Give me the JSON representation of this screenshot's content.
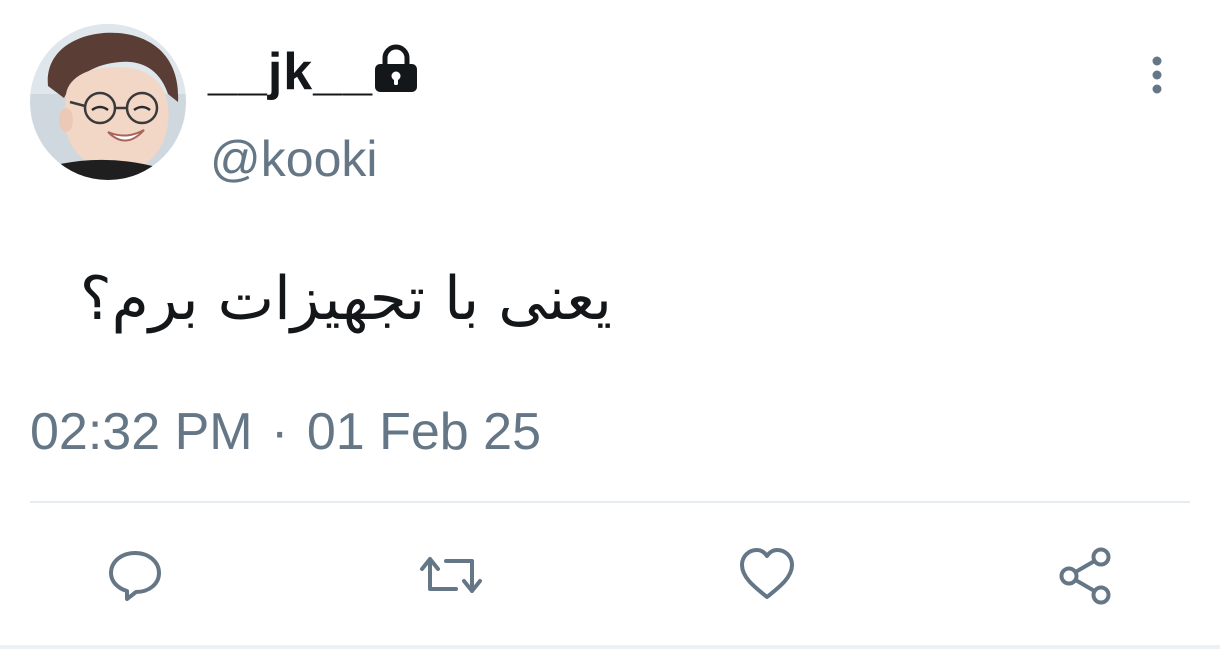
{
  "tweet": {
    "display_name": "__jk__",
    "handle": "@kooki",
    "text": "یعنی با تجهیزات برم؟",
    "time": "02:32 PM",
    "separator": "·",
    "date": "01 Feb 25",
    "protected": true
  },
  "icons": {
    "lock": "lock-icon",
    "menu": "more-vertical-icon",
    "reply": "reply-icon",
    "retweet": "retweet-icon",
    "like": "heart-icon",
    "share": "share-icon"
  },
  "colors": {
    "text_primary": "#14171a",
    "text_secondary": "#657786",
    "divider": "#e6ecf0"
  }
}
